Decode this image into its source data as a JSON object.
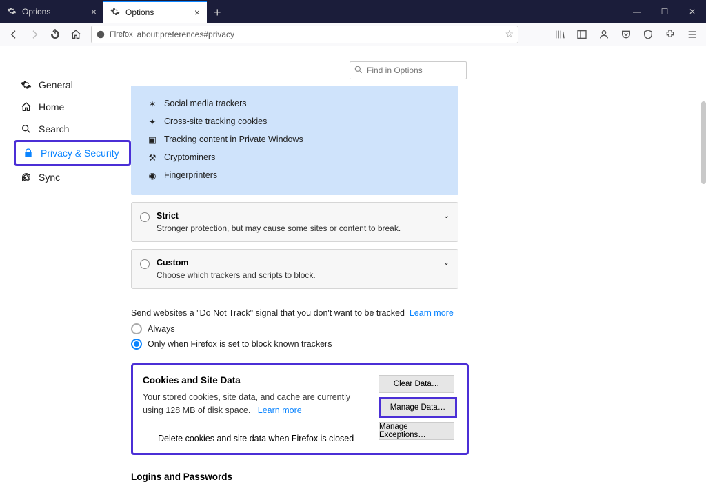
{
  "window": {
    "title": "Options"
  },
  "tabs": [
    {
      "label": "Options",
      "active": false
    },
    {
      "label": "Options",
      "active": true
    }
  ],
  "urlbar": {
    "identity": "Firefox",
    "url": "about:preferences#privacy"
  },
  "search": {
    "placeholder": "Find in Options"
  },
  "sidebar": {
    "general": "General",
    "home": "Home",
    "search": "Search",
    "privacy": "Privacy & Security",
    "sync": "Sync"
  },
  "tracking": {
    "items": [
      "Social media trackers",
      "Cross-site tracking cookies",
      "Tracking content in Private Windows",
      "Cryptominers",
      "Fingerprinters"
    ]
  },
  "levels": {
    "strict": {
      "title": "Strict",
      "desc": "Stronger protection, but may cause some sites or content to break."
    },
    "custom": {
      "title": "Custom",
      "desc": "Choose which trackers and scripts to block."
    }
  },
  "dnt": {
    "intro": "Send websites a \"Do Not Track\" signal that you don't want to be tracked",
    "learn": "Learn more",
    "opt_always": "Always",
    "opt_known": "Only when Firefox is set to block known trackers"
  },
  "cookies": {
    "heading": "Cookies and Site Data",
    "desc": "Your stored cookies, site data, and cache are currently using 128 MB of disk space.",
    "learn": "Learn more",
    "delete_label": "Delete cookies and site data when Firefox is closed",
    "btn_clear": "Clear Data…",
    "btn_manage": "Manage Data…",
    "btn_exceptions": "Manage Exceptions…"
  },
  "logins": {
    "heading": "Logins and Passwords"
  }
}
